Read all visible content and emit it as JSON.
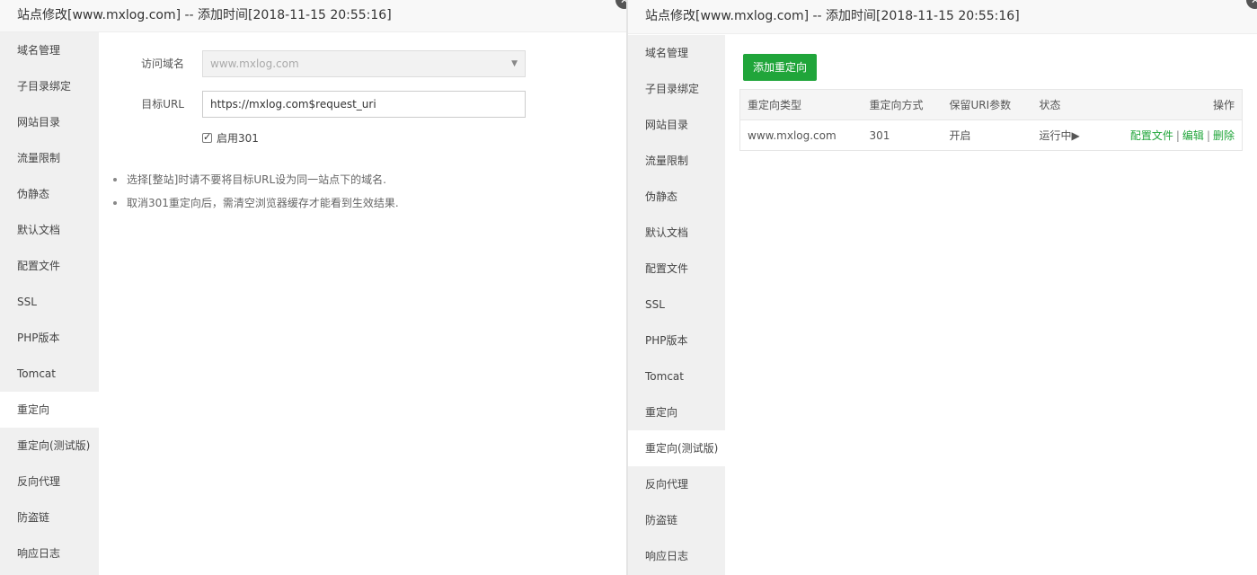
{
  "left_panel": {
    "title": "站点修改[www.mxlog.com] -- 添加时间[2018-11-15 20:55:16]",
    "close_icon": "✕",
    "sidebar": [
      {
        "label": "域名管理"
      },
      {
        "label": "子目录绑定"
      },
      {
        "label": "网站目录"
      },
      {
        "label": "流量限制"
      },
      {
        "label": "伪静态"
      },
      {
        "label": "默认文档"
      },
      {
        "label": "配置文件"
      },
      {
        "label": "SSL"
      },
      {
        "label": "PHP版本"
      },
      {
        "label": "Tomcat"
      },
      {
        "label": "重定向"
      },
      {
        "label": "重定向(测试版)"
      },
      {
        "label": "反向代理"
      },
      {
        "label": "防盗链"
      },
      {
        "label": "响应日志"
      }
    ],
    "active_item": "重定向",
    "form": {
      "domain_label": "访问域名",
      "domain_value": "www.mxlog.com",
      "target_label": "目标URL",
      "target_value": "https://mxlog.com$request_uri",
      "enable_301_label": "启用301",
      "enable_301_checked": true
    },
    "tips": [
      "选择[整站]时请不要将目标URL设为同一站点下的域名.",
      "取消301重定向后，需清空浏览器缓存才能看到生效结果."
    ]
  },
  "right_panel": {
    "title": "站点修改[www.mxlog.com] -- 添加时间[2018-11-15 20:55:16]",
    "close_icon": "✕",
    "sidebar": [
      {
        "label": "域名管理"
      },
      {
        "label": "子目录绑定"
      },
      {
        "label": "网站目录"
      },
      {
        "label": "流量限制"
      },
      {
        "label": "伪静态"
      },
      {
        "label": "默认文档"
      },
      {
        "label": "配置文件"
      },
      {
        "label": "SSL"
      },
      {
        "label": "PHP版本"
      },
      {
        "label": "Tomcat"
      },
      {
        "label": "重定向"
      },
      {
        "label": "重定向(测试版)"
      },
      {
        "label": "反向代理"
      },
      {
        "label": "防盗链"
      },
      {
        "label": "响应日志"
      }
    ],
    "active_item": "重定向(测试版)",
    "add_button": "添加重定向",
    "table": {
      "headers": [
        "重定向类型",
        "重定向方式",
        "保留URI参数",
        "状态",
        "操作"
      ],
      "rows": [
        {
          "type": "www.mxlog.com",
          "method": "301",
          "keep_uri": "开启",
          "status": "运行中",
          "status_icon": "▶",
          "actions": [
            "配置文件",
            "编辑",
            "删除"
          ]
        }
      ]
    }
  },
  "colors": {
    "accent_green": "#20a53a",
    "sidebar_bg": "#f0f0f0",
    "title_bg": "#f8f8f8"
  }
}
